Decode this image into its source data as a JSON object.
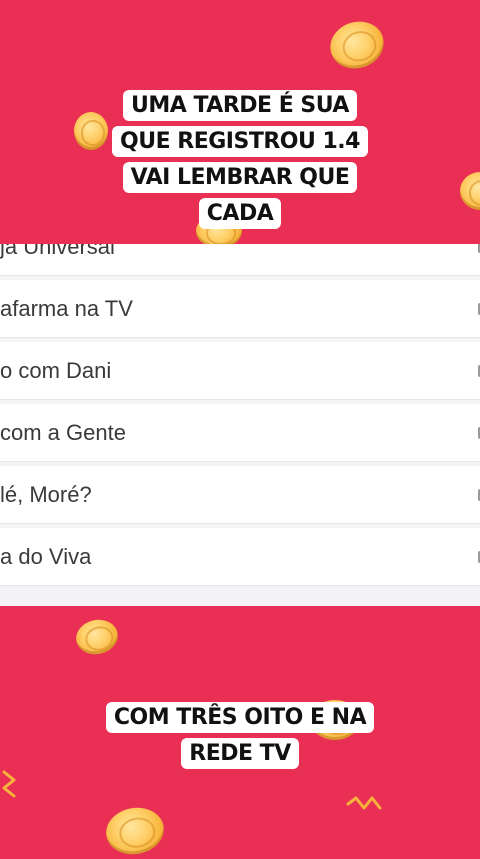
{
  "top_caption": {
    "lines": [
      "UMA TARDE É SUA",
      "QUE REGISTROU 1.4",
      "VAI LEMBRAR QUE",
      "CADA"
    ]
  },
  "list": {
    "items": [
      {
        "label": "ja Universal",
        "icon": "chevron-right-icon"
      },
      {
        "label": "afarma na TV",
        "icon": "chevron-right-icon"
      },
      {
        "label": "o com Dani",
        "icon": "chevron-right-icon"
      },
      {
        "label": "com a Gente",
        "icon": "chevron-right-icon"
      },
      {
        "label": "lé, Moré?",
        "icon": "chevron-right-icon"
      },
      {
        "label": "a do Viva",
        "icon": "chevron-right-icon"
      }
    ]
  },
  "bottom_caption": {
    "lines": [
      "COM TRÊS OITO E NA",
      "REDE TV"
    ]
  },
  "colors": {
    "background": "#ea2f55",
    "caption_bg": "#ffffff",
    "coin": "#f7b43c"
  }
}
